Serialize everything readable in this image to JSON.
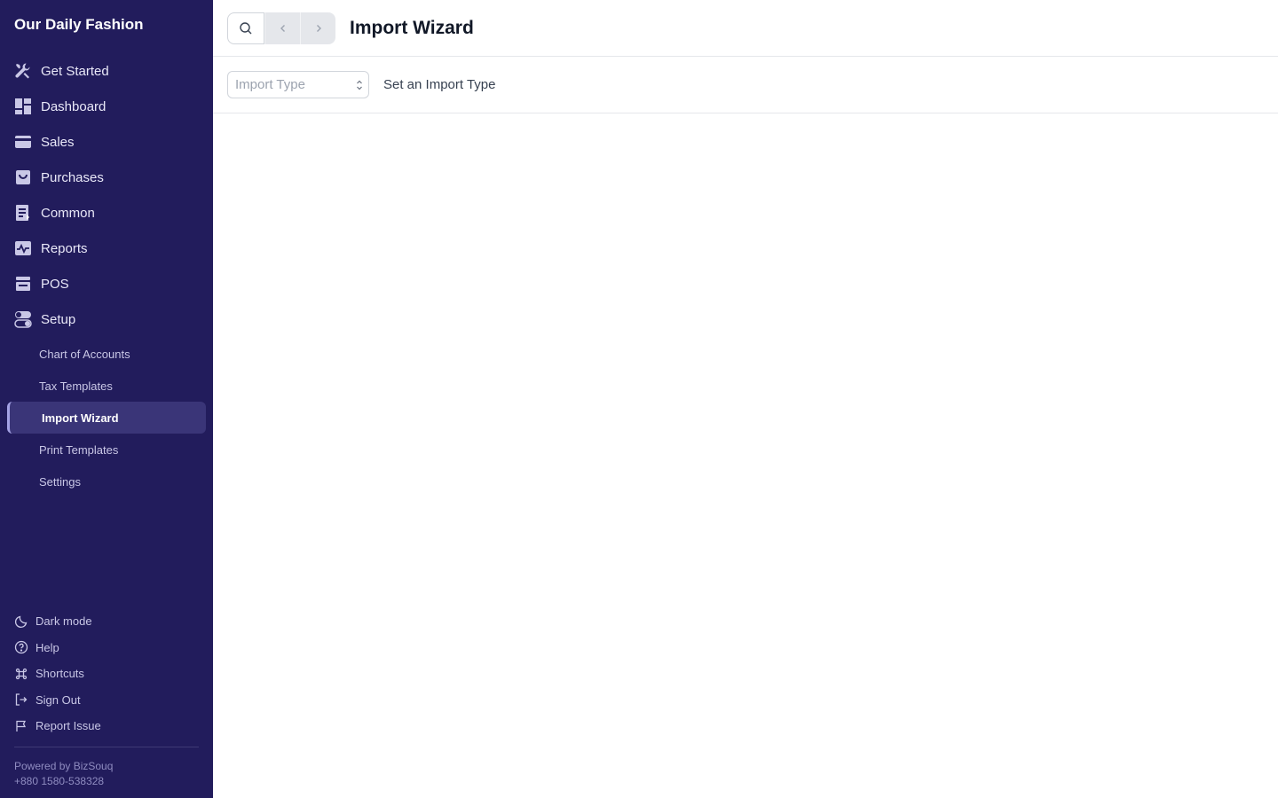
{
  "sidebar": {
    "company_name": "Our Daily Fashion",
    "nav": [
      {
        "label": "Get Started",
        "icon": "tools-icon"
      },
      {
        "label": "Dashboard",
        "icon": "dashboard-icon"
      },
      {
        "label": "Sales",
        "icon": "sales-icon"
      },
      {
        "label": "Purchases",
        "icon": "purchases-icon"
      },
      {
        "label": "Common",
        "icon": "common-icon"
      },
      {
        "label": "Reports",
        "icon": "reports-icon"
      },
      {
        "label": "POS",
        "icon": "pos-icon"
      },
      {
        "label": "Setup",
        "icon": "setup-icon"
      }
    ],
    "setup_items": [
      {
        "label": "Chart of Accounts"
      },
      {
        "label": "Tax Templates"
      },
      {
        "label": "Import Wizard",
        "active": true
      },
      {
        "label": "Print Templates"
      },
      {
        "label": "Settings"
      }
    ],
    "bottom": [
      {
        "label": "Dark mode",
        "icon": "moon-icon"
      },
      {
        "label": "Help",
        "icon": "help-icon"
      },
      {
        "label": "Shortcuts",
        "icon": "command-icon"
      },
      {
        "label": "Sign Out",
        "icon": "sign-out-icon"
      },
      {
        "label": "Report Issue",
        "icon": "flag-icon"
      }
    ],
    "powered_by": "Powered by BizSouq",
    "phone": "+880 1580-538328"
  },
  "header": {
    "title": "Import Wizard"
  },
  "import": {
    "select_placeholder": "Import Type",
    "hint": "Set an Import Type"
  },
  "colors": {
    "sidebar_bg": "#221c5c",
    "active_item_bg": "#3a3578"
  }
}
